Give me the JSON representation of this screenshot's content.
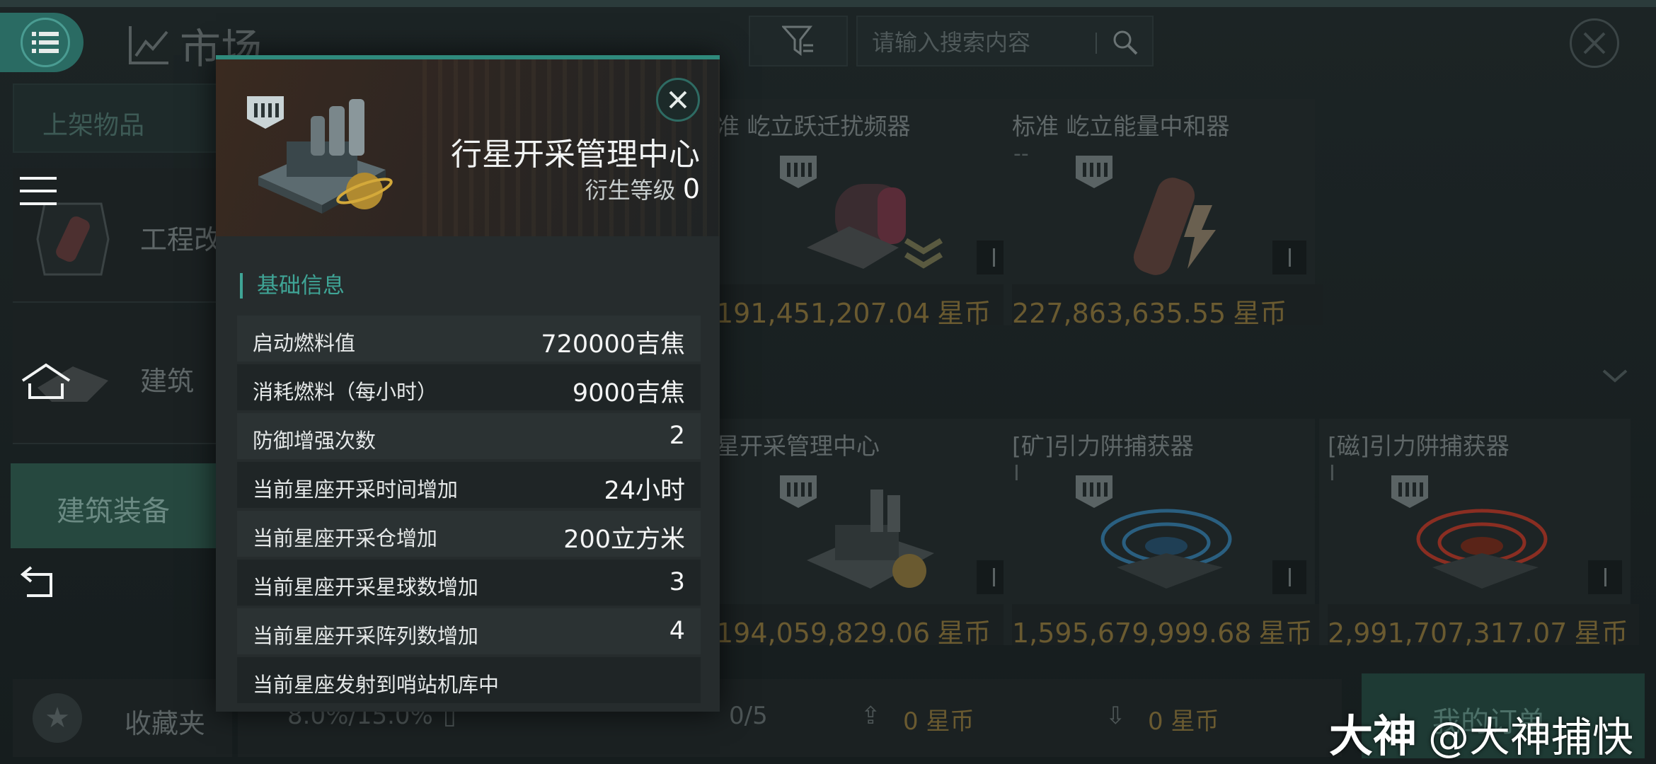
{
  "market": {
    "title": "市场",
    "search_placeholder": "请输入搜索内容"
  },
  "sidebar": {
    "listed_tab": "上架物品",
    "items": [
      {
        "label": "工程改"
      },
      {
        "label": "建筑"
      }
    ],
    "category": "建筑",
    "selected_category": "建筑装备",
    "favorites": "收藏夹"
  },
  "cards": [
    {
      "title": "准 屹立跃迁扰频器",
      "price": "191,451,207.04",
      "unit": "星币",
      "sub": ""
    },
    {
      "title": "标准 屹立能量中和器",
      "price": "227,863,635.55",
      "unit": "星币",
      "sub": "--"
    },
    {
      "title": "星开采管理中心",
      "price": "194,059,829.06",
      "unit": "星币",
      "sub": ""
    },
    {
      "title": "[矿]引力阱捕获器",
      "price": "1,595,679,999.68",
      "unit": "星币",
      "sub": "I"
    },
    {
      "title": "[磁]引力阱捕获器",
      "price": "2,991,707,317.07",
      "unit": "星币",
      "sub": "I"
    }
  ],
  "bottom_bar": {
    "tax": "8.0%/15.0%",
    "orders": "0/5",
    "sell_amount": "0 星币",
    "buy_amount": "0 星币",
    "right_button": "我的订单"
  },
  "popup": {
    "title": "行星开采管理中心",
    "level_label": "衍生等级",
    "level_value": "0",
    "section": "基础信息",
    "rows": [
      {
        "key": "启动燃料值",
        "value": "720000吉焦"
      },
      {
        "key": "消耗燃料（每小时）",
        "value": "9000吉焦"
      },
      {
        "key": "防御增强次数",
        "value": "2"
      },
      {
        "key": "当前星座开采时间增加",
        "value": "24小时"
      },
      {
        "key": "当前星座开采仓增加",
        "value": "200立方米"
      },
      {
        "key": "当前星座开采星球数增加",
        "value": "3"
      },
      {
        "key": "当前星座开采阵列数增加",
        "value": "4"
      },
      {
        "key": "当前星座发射到哨站机库中",
        "value": ""
      }
    ]
  },
  "watermark": {
    "logo": "大神",
    "handle": "@大神捕快"
  },
  "colors": {
    "accent": "#2f8a7c",
    "gold": "#6a5a30",
    "popup_bg": "#262c2d"
  }
}
